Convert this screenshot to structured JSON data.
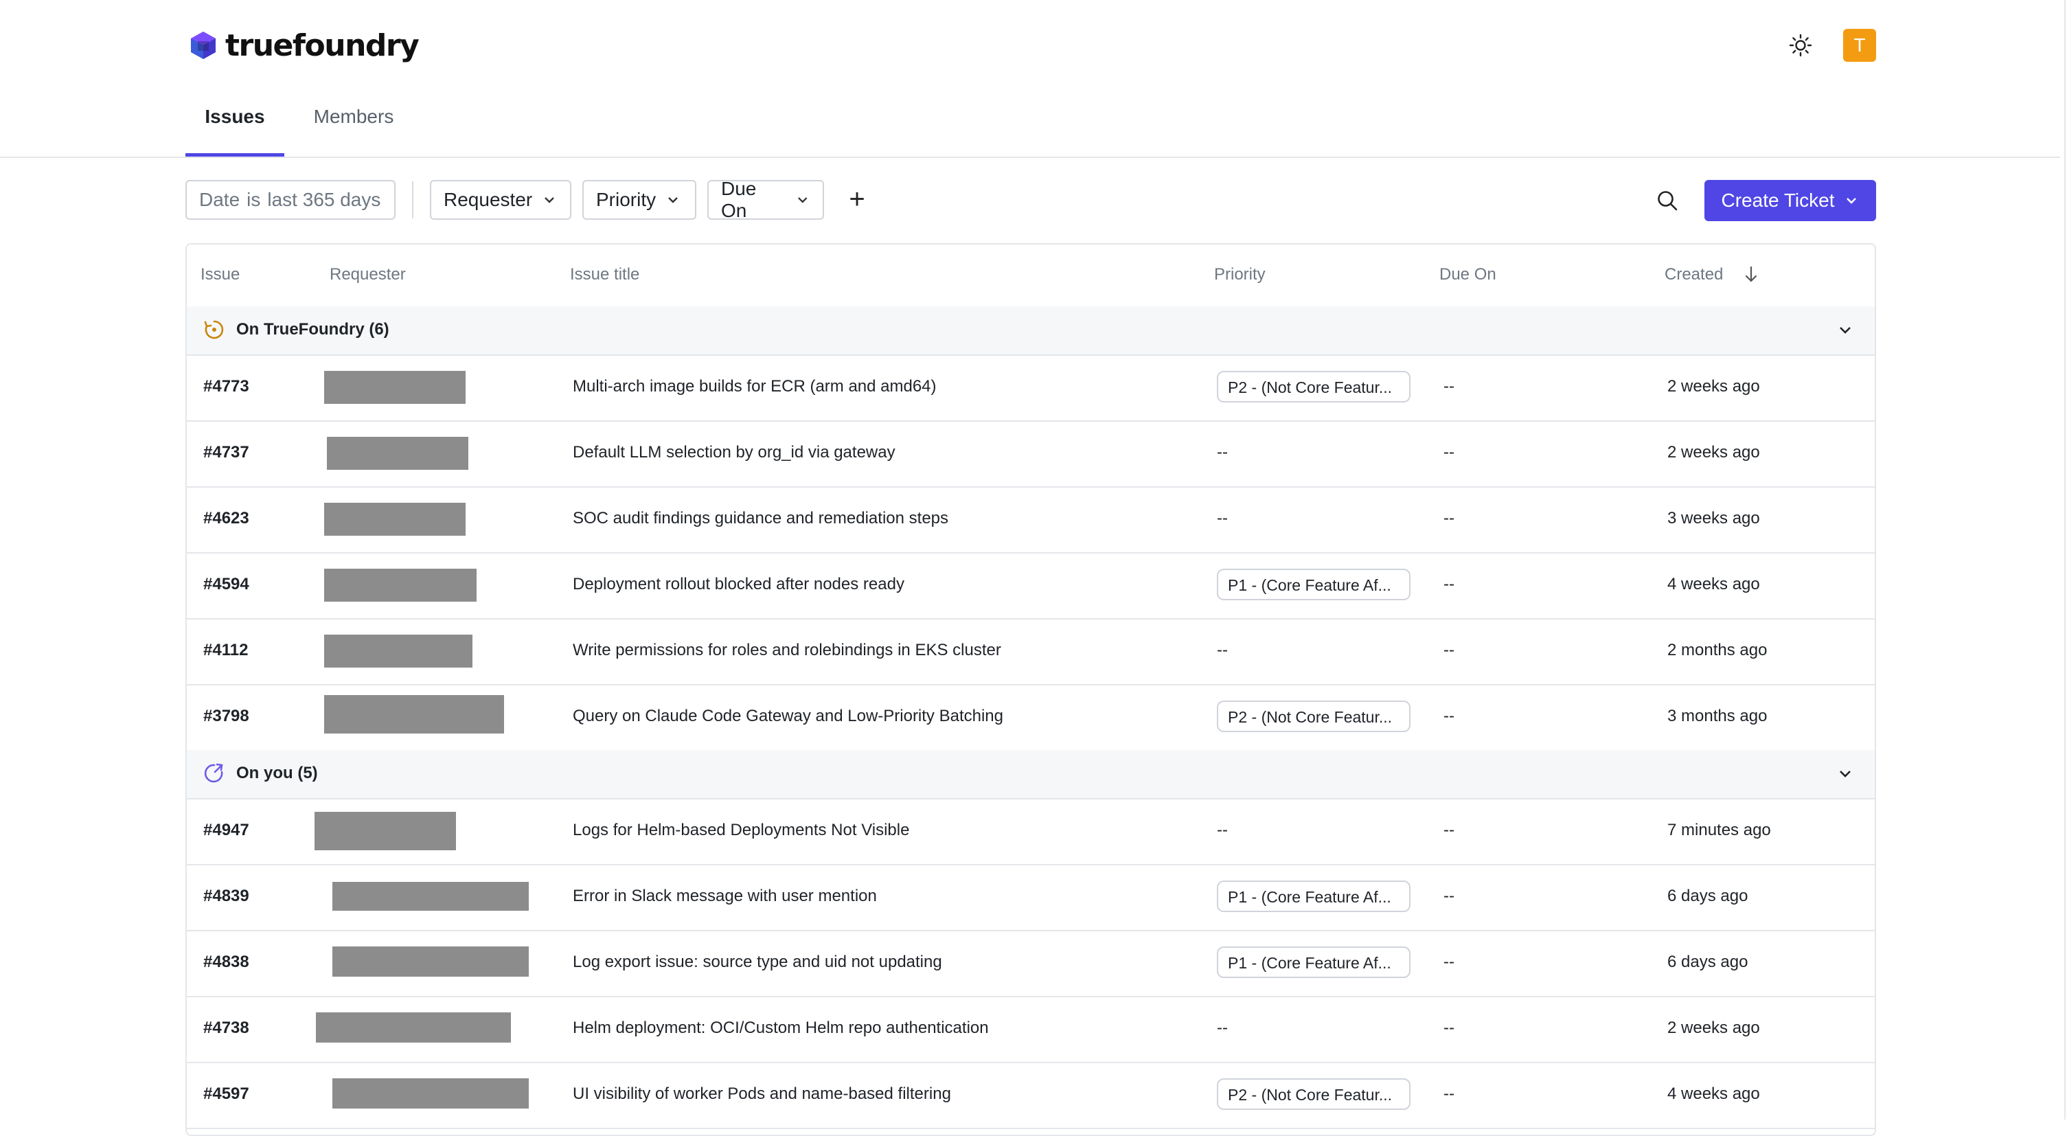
{
  "header": {
    "brand": "truefoundry",
    "avatar_initial": "T",
    "icons": {
      "logo": "truefoundry-logo",
      "theme": "sun-icon"
    }
  },
  "tabs": [
    {
      "label": "Issues",
      "active": true
    },
    {
      "label": "Members",
      "active": false
    }
  ],
  "filters": {
    "date": {
      "field": "Date",
      "op": "is",
      "value": "last 365 days"
    },
    "requester": "Requester",
    "priority": "Priority",
    "due_on": "Due On",
    "add": "+"
  },
  "actions": {
    "create_ticket": "Create Ticket"
  },
  "colors": {
    "accent": "#4f46e5",
    "avatar": "#f39c12",
    "group_bg": "#f6f7f9"
  },
  "table": {
    "columns": [
      "Issue",
      "Requester",
      "Issue title",
      "Priority",
      "Due On",
      "Created"
    ],
    "sort": "Created descending",
    "groups": [
      {
        "label": "On TrueFoundry (6)",
        "icon": "truefoundry-status-icon",
        "rows": [
          {
            "id": "#4773",
            "title": "Multi-arch image builds for ECR (arm and amd64)",
            "priority": "P2 - (Not Core Featur...",
            "due": "--",
            "created": "2 weeks ago"
          },
          {
            "id": "#4737",
            "title": "Default LLM selection by org_id via gateway",
            "priority": "--",
            "due": "--",
            "created": "2 weeks ago"
          },
          {
            "id": "#4623",
            "title": "SOC audit findings guidance and remediation steps",
            "priority": "--",
            "due": "--",
            "created": "3 weeks ago"
          },
          {
            "id": "#4594",
            "title": "Deployment rollout blocked after nodes ready",
            "priority": "P1 - (Core Feature Af...",
            "due": "--",
            "created": "4 weeks ago"
          },
          {
            "id": "#4112",
            "title": "Write permissions for roles and rolebindings in EKS cluster",
            "priority": "--",
            "due": "--",
            "created": "2 months ago"
          },
          {
            "id": "#3798",
            "title": "Query on Claude Code Gateway and Low-Priority Batching",
            "priority": "P2 - (Not Core Featur...",
            "due": "--",
            "created": "3 months ago"
          }
        ]
      },
      {
        "label": "On you (5)",
        "icon": "user-status-icon",
        "rows": [
          {
            "id": "#4947",
            "title": "Logs for Helm-based Deployments Not Visible",
            "priority": "--",
            "due": "--",
            "created": "7 minutes ago"
          },
          {
            "id": "#4839",
            "title": "Error in Slack message with user mention",
            "priority": "P1 - (Core Feature Af...",
            "due": "--",
            "created": "6 days ago"
          },
          {
            "id": "#4838",
            "title": "Log export issue: source type and uid not updating",
            "priority": "P1 - (Core Feature Af...",
            "due": "--",
            "created": "6 days ago"
          },
          {
            "id": "#4738",
            "title": "Helm deployment: OCI/Custom Helm repo authentication",
            "priority": "--",
            "due": "--",
            "created": "2 weeks ago"
          },
          {
            "id": "#4597",
            "title": "UI visibility of worker Pods and name-based filtering",
            "priority": "P2 - (Not Core Featur...",
            "due": "--",
            "created": "4 weeks ago"
          }
        ]
      }
    ]
  }
}
